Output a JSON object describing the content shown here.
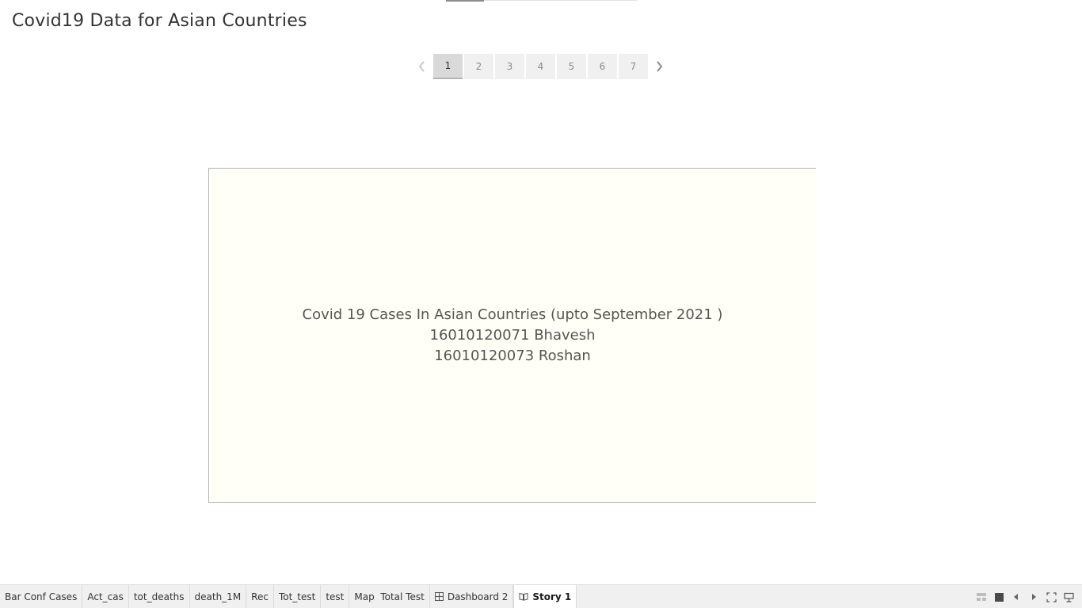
{
  "story": {
    "title": "Covid19 Data for Asian Countries",
    "progress": 0.2
  },
  "navigator": {
    "prev_icon": "chevron-left-icon",
    "next_icon": "chevron-right-icon",
    "pages": [
      "1",
      "2",
      "3",
      "4",
      "5",
      "6",
      "7"
    ],
    "active_page": "1"
  },
  "content": {
    "line1": "Covid 19 Cases In Asian Countries (upto September 2021 )",
    "line2": "16010120071 Bhavesh",
    "line3": "16010120073 Roshan",
    "background": "#fffff7"
  },
  "tabs": [
    {
      "label": "Bar Conf Cases",
      "icon": ""
    },
    {
      "label": "Act_cas",
      "icon": ""
    },
    {
      "label": "tot_deaths",
      "icon": ""
    },
    {
      "label": "death_1M",
      "icon": ""
    },
    {
      "label": "Rec",
      "icon": ""
    },
    {
      "label": "Tot_test",
      "icon": ""
    },
    {
      "label": "test",
      "icon": ""
    },
    {
      "label": "Map  Total Test",
      "icon": ""
    },
    {
      "label": "Dashboard 2",
      "icon": "dashboard-grid-icon"
    },
    {
      "label": "Story 1",
      "icon": "story-book-icon",
      "active": true
    }
  ],
  "toolbar": {
    "icons": [
      "sheet-sorter-icon",
      "filmstrip-icon",
      "previous-sheet-icon",
      "next-sheet-icon",
      "presentation-mode-icon",
      "fit-window-icon"
    ]
  },
  "colors": {
    "active_page_bg": "#d9d9d9",
    "page_bg": "#f0f0f0",
    "tabbar_bg": "#f0f0f0"
  }
}
